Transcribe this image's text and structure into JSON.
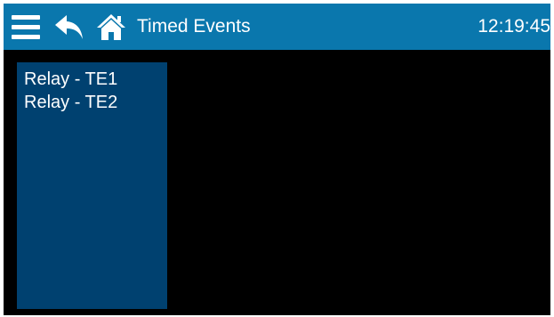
{
  "header": {
    "title": "Timed Events",
    "clock": "12:19:45",
    "menu_icon": "hamburger-menu-icon",
    "back_icon": "back-arrow-icon",
    "home_icon": "home-icon"
  },
  "events": [
    {
      "label": "Relay - TE1"
    },
    {
      "label": "Relay - TE2"
    }
  ],
  "colors": {
    "header_bg": "#0a77ad",
    "screen_bg": "#000000",
    "list_bg": "#004170",
    "text": "#ffffff"
  }
}
